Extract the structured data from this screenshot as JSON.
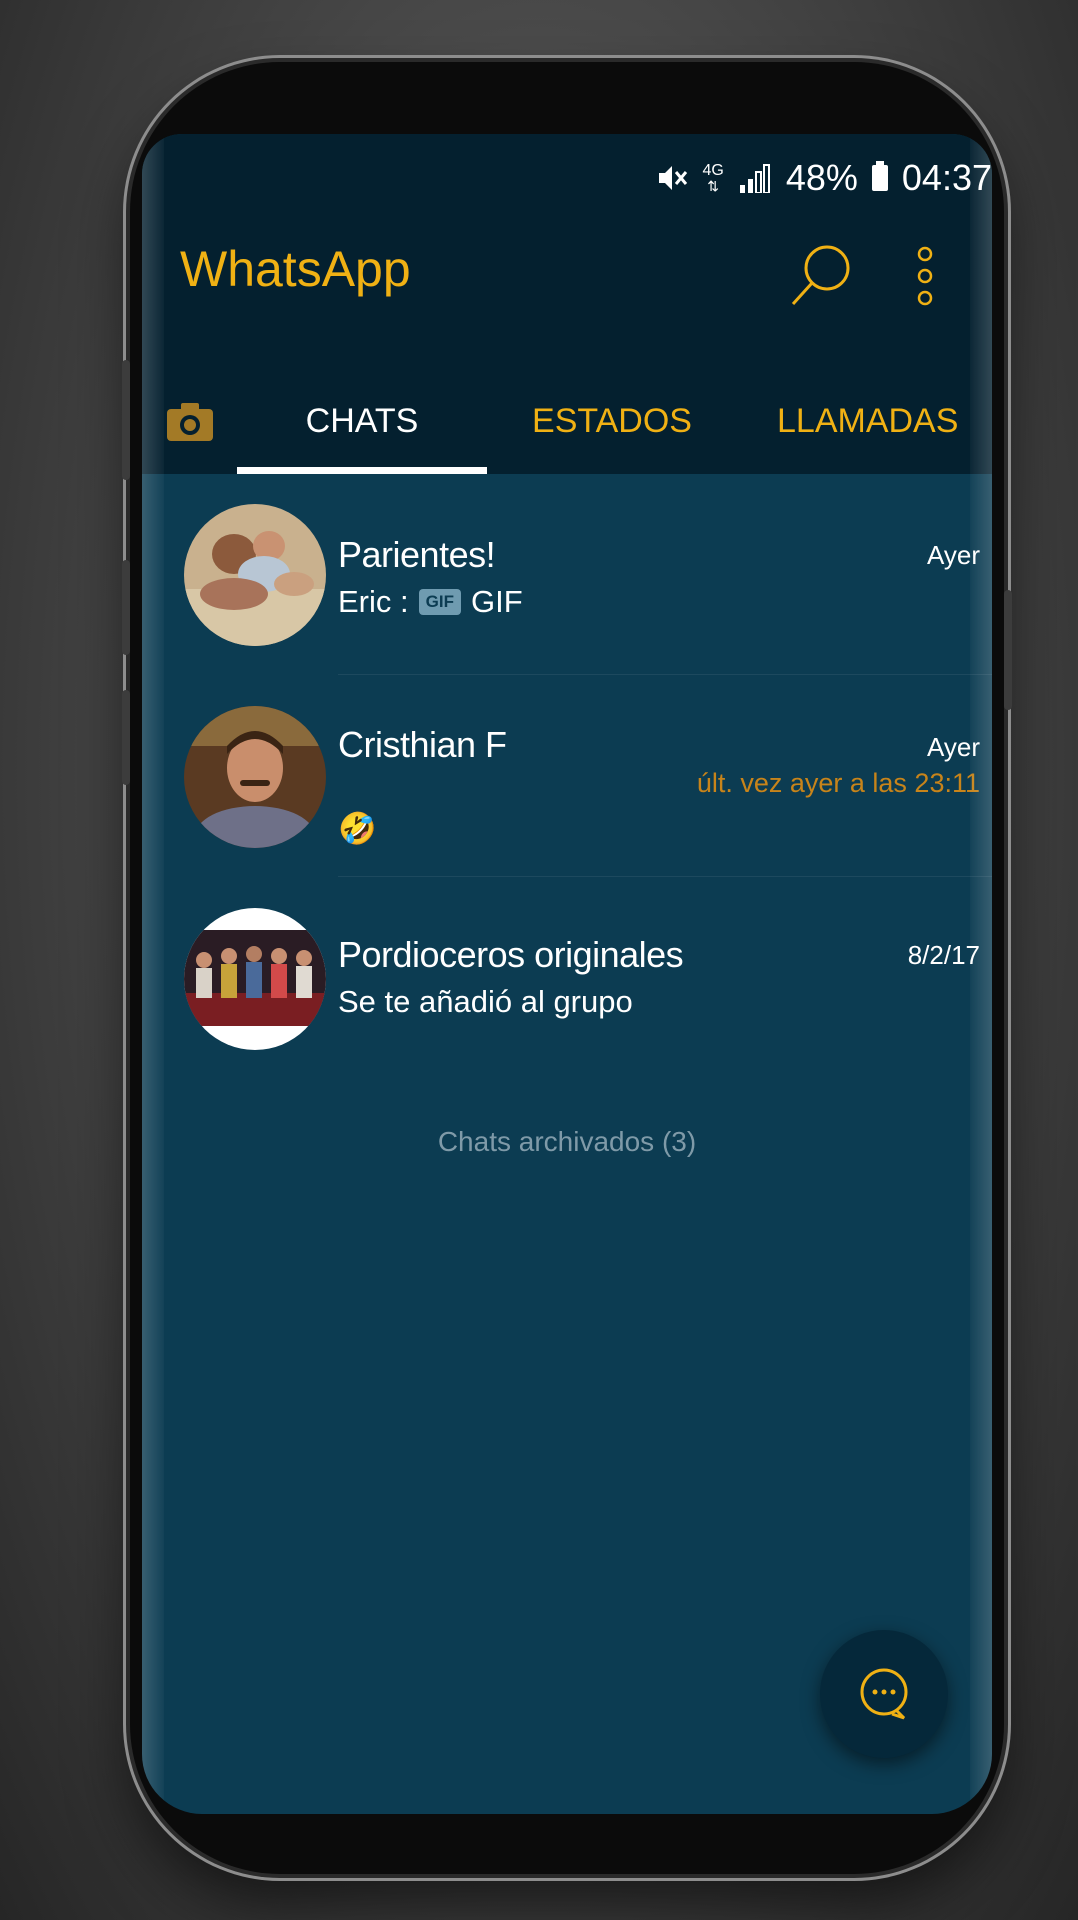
{
  "status_bar": {
    "network": "4G",
    "battery": "48%",
    "time": "04:37",
    "icons": [
      "mute-icon",
      "network-4g-icon",
      "signal-icon",
      "battery-icon"
    ]
  },
  "app_bar": {
    "title": "WhatsApp",
    "actions": [
      "search-icon",
      "overflow-menu-icon"
    ]
  },
  "tabs": [
    {
      "icon": "camera-icon",
      "label": ""
    },
    {
      "label": "CHATS",
      "selected": true
    },
    {
      "label": "ESTADOS",
      "selected": false
    },
    {
      "label": "LLAMADAS",
      "selected": false
    }
  ],
  "chats": [
    {
      "name": "Parientes!",
      "time": "Ayer",
      "sender": "Eric :",
      "badge": "GIF",
      "message": "GIF"
    },
    {
      "name": "Cristhian F",
      "time": "Ayer",
      "presence": "últ. vez ayer a las 23:11",
      "message": "🤣"
    },
    {
      "name": "Pordioceros originales",
      "time": "8/2/17",
      "message": "Se te añadió al grupo"
    }
  ],
  "archived_label": "Chats archivados (3)",
  "fab": {
    "icon": "new-chat-icon"
  },
  "colors": {
    "accent": "#f0b114",
    "header_bg": "#04202f",
    "list_bg": "#0c3c52",
    "presence": "#c8841a",
    "tab_selected": "#ffffff"
  }
}
